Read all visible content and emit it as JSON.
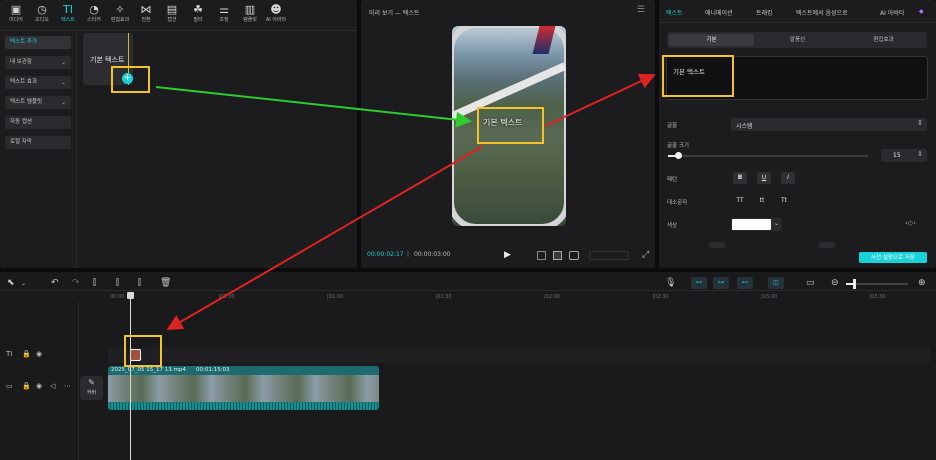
{
  "toolbar": {
    "items": [
      {
        "icon": "media-icon",
        "glyph": "▣",
        "label": "미디어"
      },
      {
        "icon": "audio-icon",
        "glyph": "◷",
        "label": "오디오"
      },
      {
        "icon": "text-icon",
        "glyph": "TI",
        "label": "텍스트",
        "active": true
      },
      {
        "icon": "sticker-icon",
        "glyph": "◔",
        "label": "스티커"
      },
      {
        "icon": "effects-icon",
        "glyph": "✧",
        "label": "편집효과"
      },
      {
        "icon": "transition-icon",
        "glyph": "⋈",
        "label": "전환"
      },
      {
        "icon": "caption-icon",
        "glyph": "▤",
        "label": "캡션"
      },
      {
        "icon": "filter-icon",
        "glyph": "☘",
        "label": "필터"
      },
      {
        "icon": "adjust-icon",
        "glyph": "⚌",
        "label": "조정"
      },
      {
        "icon": "template-icon",
        "glyph": "▥",
        "label": "템플릿"
      },
      {
        "icon": "ai-avatar-icon",
        "glyph": "☻",
        "label": "AI 아바타"
      }
    ]
  },
  "sidebar": {
    "items": [
      {
        "label": "텍스트 추가",
        "active": true,
        "chevron": false
      },
      {
        "label": "내 보관함",
        "chevron": true
      },
      {
        "label": "텍스트 효과",
        "chevron": true
      },
      {
        "label": "텍스트 템플릿",
        "chevron": true
      },
      {
        "label": "자동 캡션",
        "chevron": false
      },
      {
        "label": "로컬 자막",
        "chevron": false
      }
    ]
  },
  "card": {
    "label": "기본 텍스트",
    "add_glyph": "+"
  },
  "preview": {
    "title": "미리 보기 — 텍스트",
    "overlay_text": "기본 텍스트",
    "current_time": "00:00:02:17",
    "separator": "|",
    "total_time": "00:00:03:00",
    "play_glyph": "▶"
  },
  "props": {
    "tabs": [
      "텍스트",
      "애니메이션",
      "트래킹",
      "텍스트에서 음성으로",
      "AI 아바타"
    ],
    "subtabs": [
      "기본",
      "말풍선",
      "편집효과"
    ],
    "text_value": "기본 텍스트",
    "font_label": "글꼴",
    "font_value": "시스템",
    "size_label": "글꼴 크기",
    "size_value": "15",
    "size_fraction": 0.05,
    "pattern_label": "패턴",
    "pattern_buttons": [
      "B",
      "U",
      "I"
    ],
    "case_label": "대소문자",
    "case_buttons": [
      "TT",
      "tt",
      "Tt"
    ],
    "color_label": "색상",
    "color_value": "#ffffff",
    "save_label": "사전 설정으로 저장"
  },
  "timeline": {
    "ticks": [
      "00:00",
      "|00:30",
      "|01:00",
      "|01:30",
      "|02:00",
      "|02:30",
      "|03:00",
      "|03:30"
    ],
    "clip_name": "2025_07_05 15_17 13.mp4",
    "clip_duration": "00:01:15:03",
    "cover_label": "커버",
    "cover_icon": "✎"
  },
  "colors": {
    "accent": "#19d1d8",
    "highlight": "#f2c32b",
    "arrow_green": "#2ecc2e",
    "arrow_red": "#dd2222"
  }
}
